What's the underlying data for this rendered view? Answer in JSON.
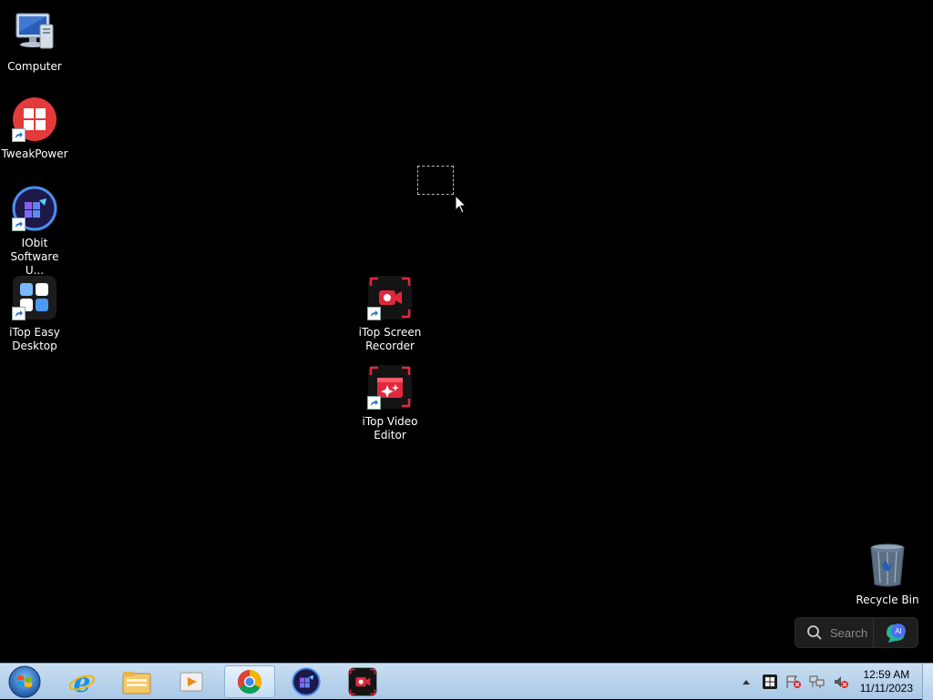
{
  "desktop": {
    "icons": [
      {
        "label": "Computer"
      },
      {
        "label": "TweakPower"
      },
      {
        "label": "IObit\nSoftware U..."
      },
      {
        "label": "iTop Easy\nDesktop"
      },
      {
        "label": "iTop Screen\nRecorder"
      },
      {
        "label": "iTop Video\nEditor"
      },
      {
        "label": "Recycle Bin"
      }
    ]
  },
  "search_widget": {
    "placeholder": "Search",
    "ai_label": "AI"
  },
  "taskbar": {
    "pinned": [
      {
        "icon": "internet-explorer-icon"
      },
      {
        "icon": "file-explorer-icon"
      },
      {
        "icon": "media-player-icon"
      },
      {
        "icon": "chrome-icon",
        "active": true
      },
      {
        "icon": "iobit-software-updater-icon"
      },
      {
        "icon": "itop-screen-recorder-icon"
      }
    ],
    "tray": {
      "time": "12:59 AM",
      "date": "11/11/2023"
    }
  },
  "colors": {
    "desktop_bg": "#000000",
    "taskbar_top": "#c9dff2",
    "taskbar_bottom": "#a9c7e6",
    "itop_red": "#e0283c",
    "accent_blue": "#3b6fd8"
  }
}
